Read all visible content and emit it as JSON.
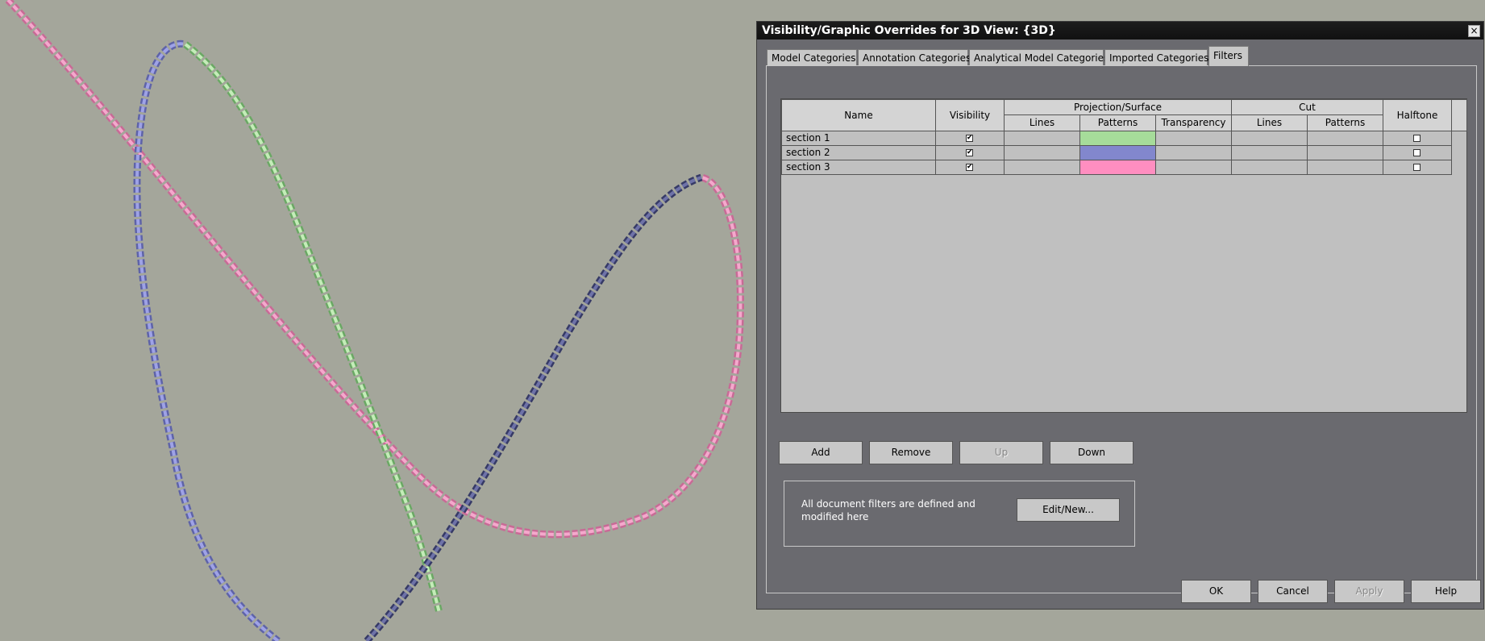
{
  "dialog": {
    "title": "Visibility/Graphic Overrides for 3D View: {3D}",
    "close_glyph": "×"
  },
  "tabs": [
    {
      "label": "Model Categories",
      "active": false
    },
    {
      "label": "Annotation Categories",
      "active": false
    },
    {
      "label": "Analytical Model Categories",
      "active": false
    },
    {
      "label": "Imported Categories",
      "active": false
    },
    {
      "label": "Filters",
      "active": true
    }
  ],
  "table": {
    "headers": {
      "name": "Name",
      "visibility": "Visibility",
      "projection_surface": "Projection/Surface",
      "proj_lines": "Lines",
      "proj_patterns": "Patterns",
      "proj_transparency": "Transparency",
      "cut": "Cut",
      "cut_lines": "Lines",
      "cut_patterns": "Patterns",
      "halftone": "Halftone"
    },
    "rows": [
      {
        "name": "section 1",
        "visible": true,
        "pattern_color": "#a6dc9a",
        "halftone": false
      },
      {
        "name": "section 2",
        "visible": true,
        "pattern_color": "#8287cd",
        "halftone": false
      },
      {
        "name": "section 3",
        "visible": true,
        "pattern_color": "#ff8ec0",
        "halftone": false
      }
    ],
    "check_glyph": "✔"
  },
  "buttons": {
    "add": "Add",
    "remove": "Remove",
    "up": "Up",
    "down": "Down",
    "edit_new": "Edit/New...",
    "ok": "OK",
    "cancel": "Cancel",
    "apply": "Apply",
    "help": "Help"
  },
  "info": {
    "text": "All document filters are defined and modified here"
  },
  "viewport": {
    "background": "#a4a69b",
    "chains": [
      {
        "name": "section 1",
        "color": "#9fd88f"
      },
      {
        "name": "section 2",
        "color": "#7f84d2"
      },
      {
        "name": "section 3",
        "color": "#f08cbc"
      },
      {
        "name": "dark chain",
        "color": "#4a4d7c"
      }
    ]
  }
}
